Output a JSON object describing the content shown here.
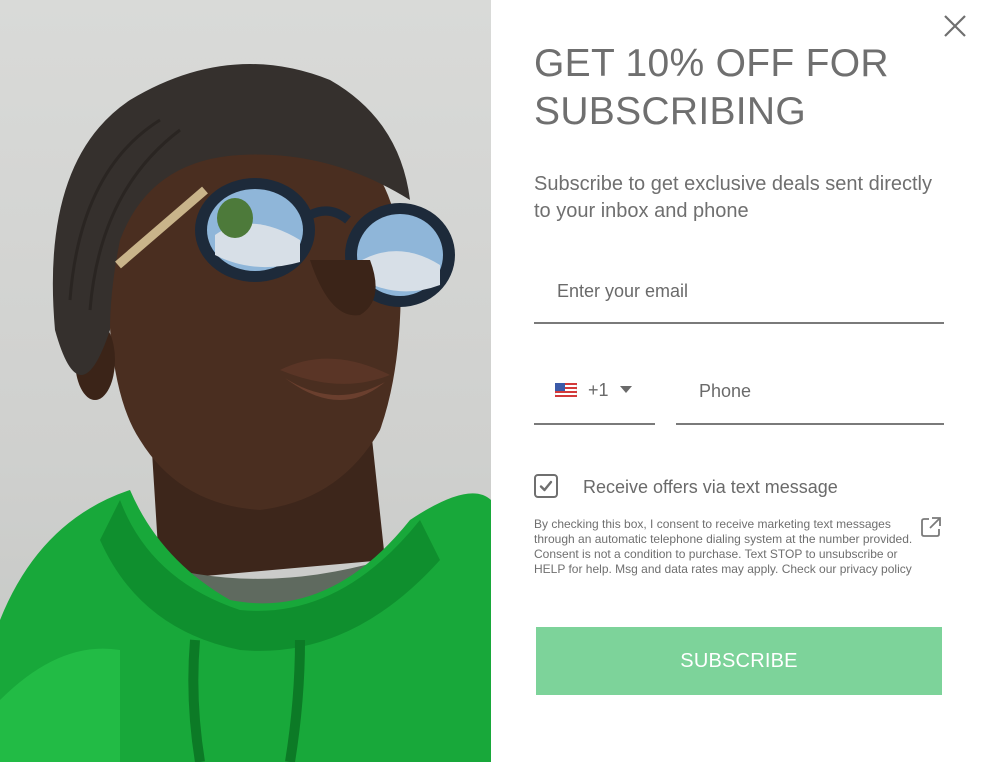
{
  "popup": {
    "headline": "GET 10% OFF FOR SUBSCRIBING",
    "subtitle": "Subscribe to get exclusive deals sent directly to your inbox and phone",
    "email": {
      "placeholder": "Enter your email",
      "value": ""
    },
    "phone": {
      "country_flag": "us-flag-icon",
      "dial_code": "+1",
      "placeholder": "Phone",
      "value": ""
    },
    "sms_opt_in": {
      "checked": true,
      "label": "Receive offers via text message"
    },
    "consent_text": "By checking this box, I consent to receive marketing text messages through an automatic telephone dialing system at the number provided. Consent is not a condition to purchase. Text STOP to unsubscribe or HELP for help. Msg and data rates may apply. Check our privacy policy",
    "subscribe_label": "SUBSCRIBE",
    "icons": {
      "close": "close-icon",
      "dropdown": "chevron-down-icon",
      "checkbox": "check-icon",
      "external": "external-link-icon"
    },
    "colors": {
      "accent_button": "#7dd39a",
      "text": "#6f6f6f",
      "hoodie": "#18a83a"
    }
  }
}
